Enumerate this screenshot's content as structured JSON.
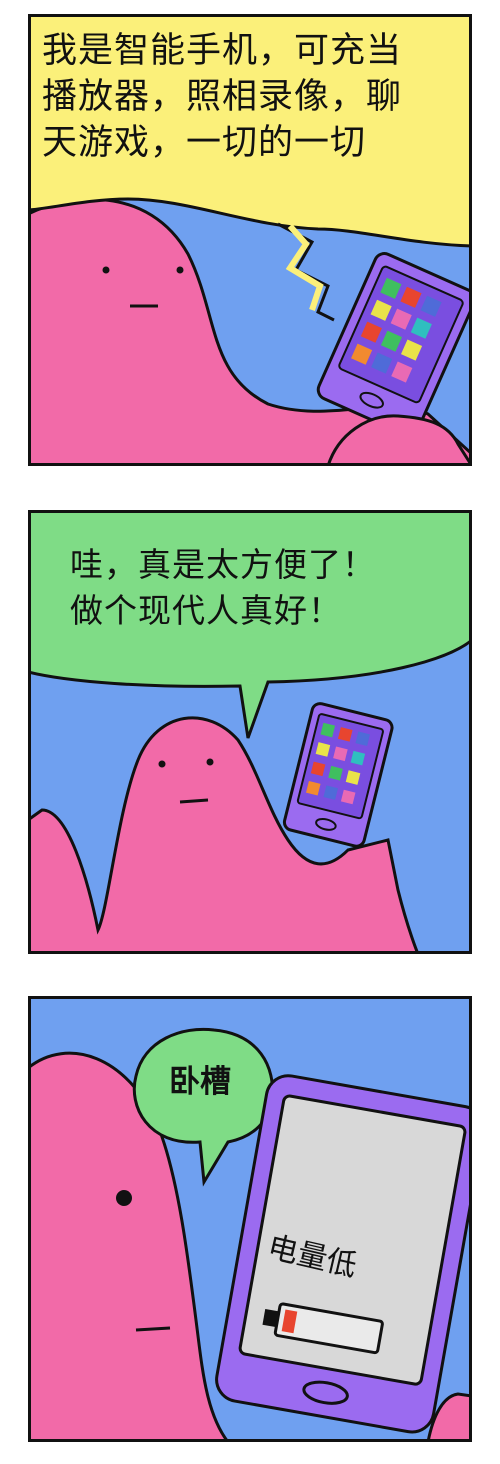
{
  "panels": [
    {
      "caption": "我是智能手机，可充当\n播放器，照相录像，聊\n天游戏，一切的一切"
    },
    {
      "caption": "哇，真是太方便了！\n做个现代人真好！"
    },
    {
      "caption": "卧槽",
      "phone_screen_text": "电量低"
    }
  ],
  "colors": {
    "sky_blue": "#6fa0f0",
    "blob_pink": "#f26aa8",
    "caption_yellow": "#fbf07a",
    "bubble_green": "#7fdc86",
    "phone_purple": "#9b6bf0",
    "screen_grey": "#d8d8d8",
    "battery_red": "#e8452f"
  }
}
